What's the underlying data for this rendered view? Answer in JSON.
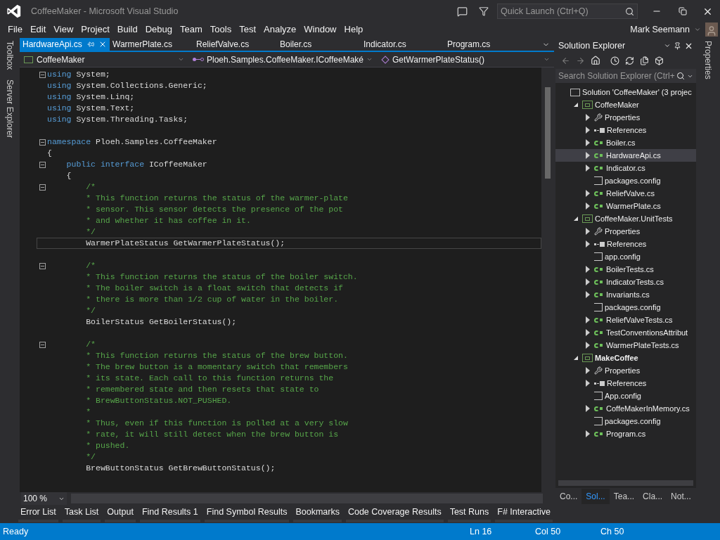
{
  "window": {
    "title": "CoffeeMaker - Microsoft Visual Studio",
    "quick_launch": {
      "placeholder": "Quick Launch (Ctrl+Q)"
    },
    "user": "Mark Seemann"
  },
  "menu": [
    "File",
    "Edit",
    "View",
    "Project",
    "Build",
    "Debug",
    "Team",
    "Tools",
    "Test",
    "Analyze",
    "Window",
    "Help"
  ],
  "left_strip": [
    "Toolbox",
    "Server Explorer"
  ],
  "right_strip": [
    "Properties"
  ],
  "document_tabs": [
    {
      "label": "HardwareApi.cs",
      "selected": true
    },
    {
      "label": "WarmerPlate.cs",
      "selected": false
    },
    {
      "label": "ReliefValve.cs",
      "selected": false
    },
    {
      "label": "Boiler.cs",
      "selected": false
    },
    {
      "label": "Indicator.cs",
      "selected": false
    },
    {
      "label": "Program.cs",
      "selected": false
    }
  ],
  "nav_bar": {
    "project": "CoffeeMaker",
    "type": "Ploeh.Samples.CoffeeMaker.ICoffeeMaké",
    "member": "GetWarmerPlateStatus()"
  },
  "code": [
    {
      "fold": true,
      "current": false,
      "tokens": [
        {
          "kind": "keyword",
          "text": "using"
        },
        {
          "kind": "plain",
          "text": " System;"
        }
      ]
    },
    {
      "fold": false,
      "current": false,
      "tokens": [
        {
          "kind": "keyword",
          "text": "using"
        },
        {
          "kind": "plain",
          "text": " System.Collections.Generic;"
        }
      ]
    },
    {
      "fold": false,
      "current": false,
      "tokens": [
        {
          "kind": "keyword",
          "text": "using"
        },
        {
          "kind": "plain",
          "text": " System.Linq;"
        }
      ]
    },
    {
      "fold": false,
      "current": false,
      "tokens": [
        {
          "kind": "keyword",
          "text": "using"
        },
        {
          "kind": "plain",
          "text": " System.Text;"
        }
      ]
    },
    {
      "fold": false,
      "current": false,
      "tokens": [
        {
          "kind": "keyword",
          "text": "using"
        },
        {
          "kind": "plain",
          "text": " System.Threading.Tasks;"
        }
      ]
    },
    {
      "fold": false,
      "current": false
    },
    {
      "fold": true,
      "current": false,
      "tokens": [
        {
          "kind": "keyword",
          "text": "namespace"
        },
        {
          "kind": "plain",
          "text": " Ploeh.Samples.CoffeeMaker"
        }
      ]
    },
    {
      "fold": false,
      "current": false,
      "tokens": [
        {
          "kind": "plain",
          "text": "{"
        }
      ]
    },
    {
      "fold": true,
      "current": false,
      "tokens": [
        {
          "kind": "keyword",
          "text": "    public"
        },
        {
          "kind": "keyword",
          "text": " interface"
        },
        {
          "kind": "plain",
          "text": " ICoffeeMaker"
        }
      ]
    },
    {
      "fold": false,
      "current": false,
      "tokens": [
        {
          "kind": "plain",
          "text": "    {"
        }
      ]
    },
    {
      "fold": true,
      "current": false,
      "tokens": [
        {
          "kind": "comment",
          "text": "        /*"
        }
      ]
    },
    {
      "fold": false,
      "current": false,
      "tokens": [
        {
          "kind": "comment",
          "text": "        * This function returns the status of the warmer-plate"
        }
      ]
    },
    {
      "fold": false,
      "current": false,
      "tokens": [
        {
          "kind": "comment",
          "text": "        * sensor. This sensor detects the presence of the pot"
        }
      ]
    },
    {
      "fold": false,
      "current": false,
      "tokens": [
        {
          "kind": "comment",
          "text": "        * and whether it has coffee in it."
        }
      ]
    },
    {
      "fold": false,
      "current": false,
      "tokens": [
        {
          "kind": "comment",
          "text": "        */"
        }
      ]
    },
    {
      "fold": false,
      "current": true,
      "tokens": [
        {
          "kind": "plain",
          "text": "        WarmerPlateStatus GetWarmerPlateStatus();"
        }
      ]
    },
    {
      "fold": false,
      "current": false
    },
    {
      "fold": true,
      "current": false,
      "tokens": [
        {
          "kind": "comment",
          "text": "        /*"
        }
      ]
    },
    {
      "fold": false,
      "current": false,
      "tokens": [
        {
          "kind": "comment",
          "text": "        * This function returns the status of the boiler switch."
        }
      ]
    },
    {
      "fold": false,
      "current": false,
      "tokens": [
        {
          "kind": "comment",
          "text": "        * The boiler switch is a float switch that detects if"
        }
      ]
    },
    {
      "fold": false,
      "current": false,
      "tokens": [
        {
          "kind": "comment",
          "text": "        * there is more than 1/2 cup of water in the boiler."
        }
      ]
    },
    {
      "fold": false,
      "current": false,
      "tokens": [
        {
          "kind": "comment",
          "text": "        */"
        }
      ]
    },
    {
      "fold": false,
      "current": false,
      "tokens": [
        {
          "kind": "plain",
          "text": "        BoilerStatus GetBoilerStatus();"
        }
      ]
    },
    {
      "fold": false,
      "current": false
    },
    {
      "fold": true,
      "current": false,
      "tokens": [
        {
          "kind": "comment",
          "text": "        /*"
        }
      ]
    },
    {
      "fold": false,
      "current": false,
      "tokens": [
        {
          "kind": "comment",
          "text": "        * This function returns the status of the brew button."
        }
      ]
    },
    {
      "fold": false,
      "current": false,
      "tokens": [
        {
          "kind": "comment",
          "text": "        * The brew button is a momentary switch that remembers"
        }
      ]
    },
    {
      "fold": false,
      "current": false,
      "tokens": [
        {
          "kind": "comment",
          "text": "        * its state. Each call to this function returns the"
        }
      ]
    },
    {
      "fold": false,
      "current": false,
      "tokens": [
        {
          "kind": "comment",
          "text": "        * remembered state and then resets that state to"
        }
      ]
    },
    {
      "fold": false,
      "current": false,
      "tokens": [
        {
          "kind": "comment",
          "text": "        * BrewButtonStatus.NOT_PUSHED."
        }
      ]
    },
    {
      "fold": false,
      "current": false,
      "tokens": [
        {
          "kind": "comment",
          "text": "        *"
        }
      ]
    },
    {
      "fold": false,
      "current": false,
      "tokens": [
        {
          "kind": "comment",
          "text": "        * Thus, even if this function is polled at a very slow"
        }
      ]
    },
    {
      "fold": false,
      "current": false,
      "tokens": [
        {
          "kind": "comment",
          "text": "        * rate, it will still detect when the brew button is"
        }
      ]
    },
    {
      "fold": false,
      "current": false,
      "tokens": [
        {
          "kind": "comment",
          "text": "        * pushed."
        }
      ]
    },
    {
      "fold": false,
      "current": false,
      "tokens": [
        {
          "kind": "comment",
          "text": "        */"
        }
      ]
    },
    {
      "fold": false,
      "current": false,
      "tokens": [
        {
          "kind": "plain",
          "text": "        BrewButtonStatus GetBrewButtonStatus();"
        }
      ]
    }
  ],
  "zoom": "100 %",
  "solution_explorer": {
    "title": "Solution Explorer",
    "search": {
      "placeholder": "Search Solution Explorer (Ctrl+"
    },
    "tree": [
      {
        "kind": "solution",
        "label": "Solution 'CoffeeMaker' (3 projec",
        "selected": false,
        "children": [
          {
            "kind": "project",
            "label": "CoffeeMaker",
            "startup": false,
            "expanded": true,
            "selected": false,
            "children": [
              {
                "kind": "properties",
                "label": "Properties",
                "expanded": false,
                "selected": false
              },
              {
                "kind": "references",
                "label": "References",
                "expanded": false,
                "selected": false
              },
              {
                "kind": "csharp",
                "label": "Boiler.cs",
                "expanded": false,
                "selected": false
              },
              {
                "kind": "csharp",
                "label": "HardwareApi.cs",
                "expanded": false,
                "selected": true
              },
              {
                "kind": "csharp",
                "label": "Indicator.cs",
                "expanded": false,
                "selected": false
              },
              {
                "kind": "config",
                "label": "packages.config",
                "selected": false
              },
              {
                "kind": "csharp",
                "label": "ReliefValve.cs",
                "expanded": false,
                "selected": false
              },
              {
                "kind": "csharp",
                "label": "WarmerPlate.cs",
                "expanded": false,
                "selected": false
              }
            ]
          },
          {
            "kind": "project",
            "label": "CoffeeMaker.UnitTests",
            "startup": false,
            "expanded": true,
            "selected": false,
            "children": [
              {
                "kind": "properties",
                "label": "Properties",
                "expanded": false,
                "selected": false
              },
              {
                "kind": "references",
                "label": "References",
                "expanded": false,
                "selected": false
              },
              {
                "kind": "config",
                "label": "app.config",
                "selected": false
              },
              {
                "kind": "csharp",
                "label": "BoilerTests.cs",
                "expanded": false,
                "selected": false
              },
              {
                "kind": "csharp",
                "label": "IndicatorTests.cs",
                "expanded": false,
                "selected": false
              },
              {
                "kind": "csharp",
                "label": "Invariants.cs",
                "expanded": false,
                "selected": false
              },
              {
                "kind": "config",
                "label": "packages.config",
                "selected": false
              },
              {
                "kind": "csharp",
                "label": "ReliefValveTests.cs",
                "expanded": false,
                "selected": false
              },
              {
                "kind": "csharp",
                "label": "TestConventionsAttribut",
                "expanded": false,
                "selected": false
              },
              {
                "kind": "csharp",
                "label": "WarmerPlateTests.cs",
                "expanded": false,
                "selected": false
              }
            ]
          },
          {
            "kind": "project",
            "label": "MakeCoffee",
            "startup": true,
            "expanded": true,
            "selected": false,
            "children": [
              {
                "kind": "properties",
                "label": "Properties",
                "expanded": false,
                "selected": false
              },
              {
                "kind": "references",
                "label": "References",
                "expanded": false,
                "selected": false
              },
              {
                "kind": "config",
                "label": "App.config",
                "selected": false
              },
              {
                "kind": "csharp",
                "label": "CoffeMakerInMemory.cs",
                "expanded": false,
                "selected": false
              },
              {
                "kind": "config",
                "label": "packages.config",
                "selected": false
              },
              {
                "kind": "csharp",
                "label": "Program.cs",
                "expanded": false,
                "selected": false
              }
            ]
          }
        ]
      }
    ],
    "tabs": [
      {
        "label": "Co...",
        "selected": false
      },
      {
        "label": "Sol...",
        "selected": true
      },
      {
        "label": "Tea...",
        "selected": false
      },
      {
        "label": "Cla...",
        "selected": false
      },
      {
        "label": "Not...",
        "selected": false
      }
    ]
  },
  "bottom_tabs": [
    "Error List",
    "Task List",
    "Output",
    "Find Results 1",
    "Find Symbol Results",
    "Bookmarks",
    "Code Coverage Results",
    "Test Runs",
    "F# Interactive"
  ],
  "status_bar": {
    "message": "Ready",
    "line": "Ln 16",
    "column": "Col 50",
    "char": "Ch 50"
  }
}
